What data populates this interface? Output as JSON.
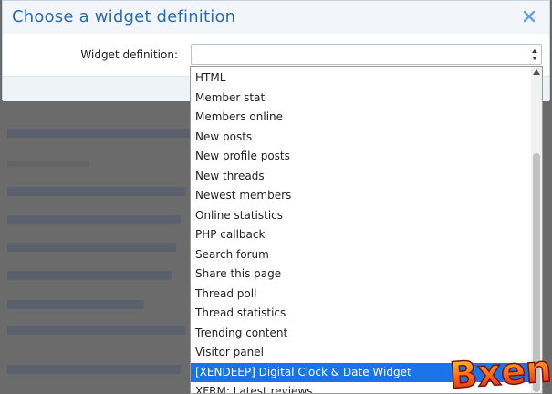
{
  "modal": {
    "title": "Choose a widget definition"
  },
  "form": {
    "label": "Widget definition:",
    "value": ""
  },
  "dropdown": {
    "options": [
      "HTML",
      "Member stat",
      "Members online",
      "New posts",
      "New profile posts",
      "New threads",
      "Newest members",
      "Online statistics",
      "PHP callback",
      "Search forum",
      "Share this page",
      "Thread poll",
      "Thread statistics",
      "Trending content",
      "Visitor panel",
      "[XENDEEP] Digital Clock & Date Widget",
      "XFRM: Latest reviews"
    ],
    "selected_index": 15
  },
  "icons": {
    "close": "close-icon",
    "select_arrow": "updown-arrow-icon",
    "scroll_up": "scroll-up-arrow-icon"
  },
  "colors": {
    "title": "#2b6cb0",
    "selected_bg": "#1a73e8"
  },
  "logo": {
    "text": "Bxen"
  }
}
